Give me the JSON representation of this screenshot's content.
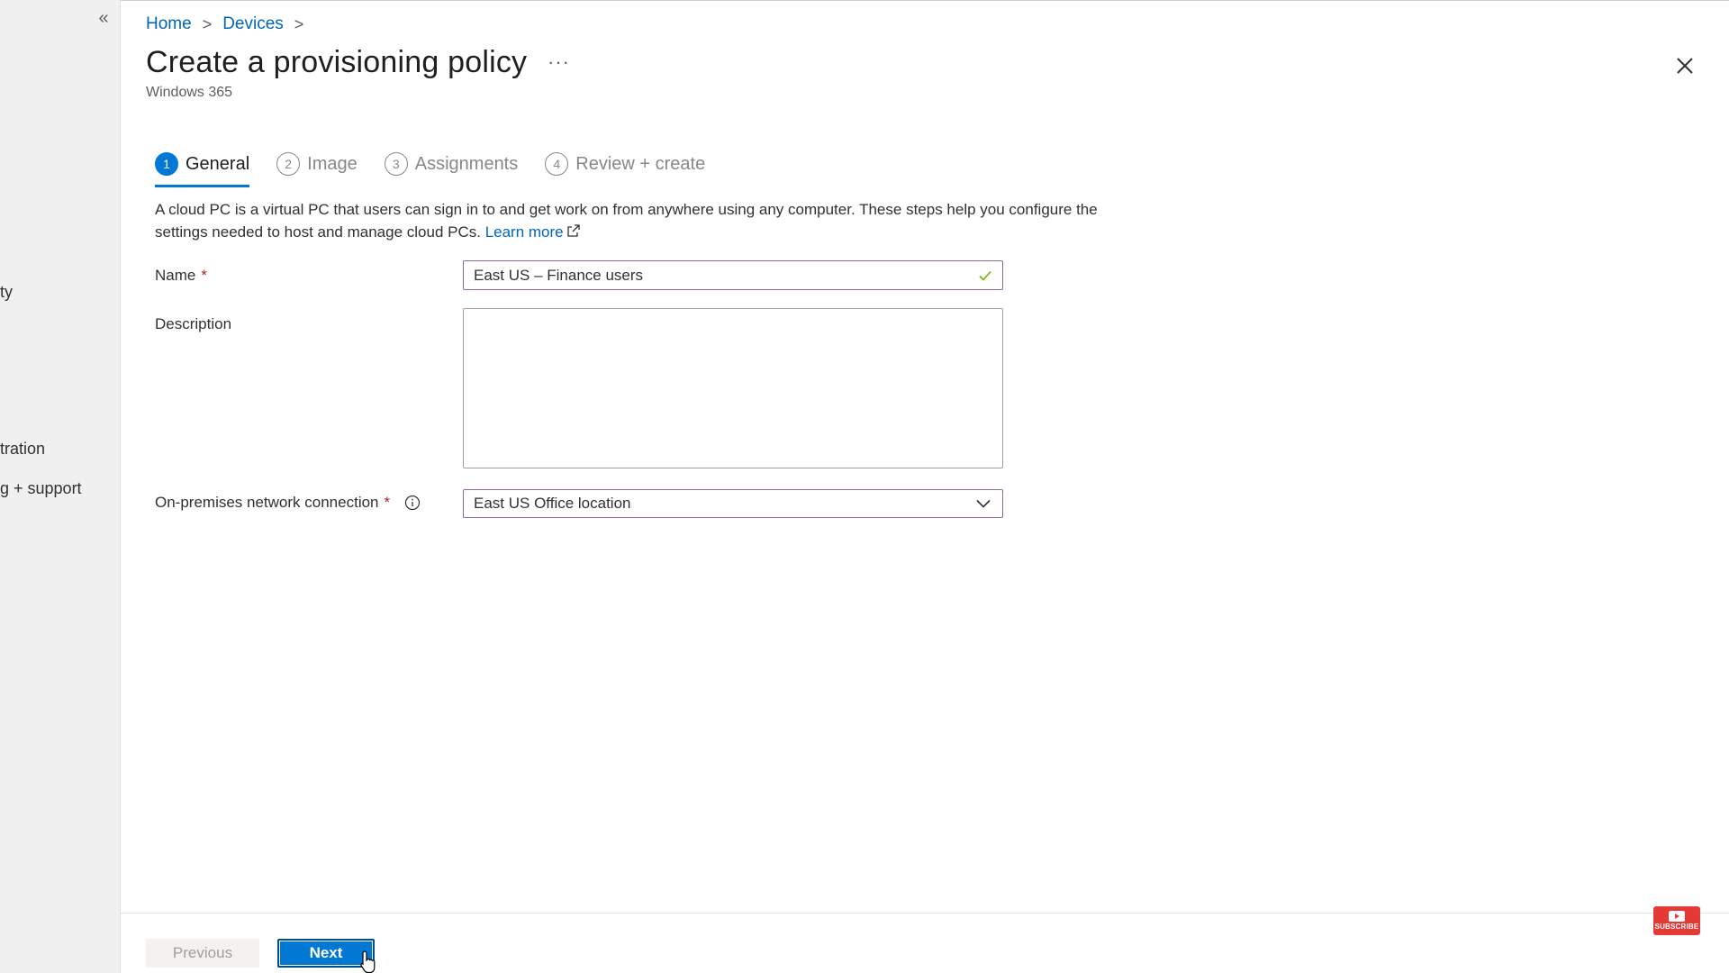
{
  "sidebar": {
    "collapse_label": "«",
    "items": [
      {
        "label": "ty"
      },
      {
        "label": "tration"
      },
      {
        "label": "g + support"
      }
    ]
  },
  "breadcrumb": {
    "items": [
      "Home",
      "Devices"
    ],
    "separator": ">"
  },
  "header": {
    "title": "Create a provisioning policy",
    "more_label": "···",
    "subtitle": "Windows 365"
  },
  "tabs": [
    {
      "number": "1",
      "label": "General",
      "active": true
    },
    {
      "number": "2",
      "label": "Image",
      "active": false
    },
    {
      "number": "3",
      "label": "Assignments",
      "active": false
    },
    {
      "number": "4",
      "label": "Review + create",
      "active": false
    }
  ],
  "intro": {
    "text": "A cloud PC is a virtual PC that users can sign in to and get work on from anywhere using any computer. These steps help you configure the settings needed to host and manage cloud PCs. ",
    "link_text": "Learn more"
  },
  "form": {
    "name": {
      "label": "Name",
      "required_mark": "*",
      "value": "East US – Finance users"
    },
    "description": {
      "label": "Description",
      "value": ""
    },
    "network": {
      "label": "On-premises network connection",
      "required_mark": "*",
      "value": "East US Office location"
    }
  },
  "footer": {
    "previous_label": "Previous",
    "next_label": "Next"
  },
  "overlay": {
    "subscribe_label": "SUBSCRIBE"
  },
  "colors": {
    "accent": "#0078d4",
    "link": "#0067b8",
    "required": "#a4262c",
    "valid_check": "#6bb700",
    "subscribe": "#e53935"
  },
  "icons": [
    "chevron-double-left-icon",
    "chevron-right-icon",
    "more-icon",
    "close-icon",
    "external-link-icon",
    "check-icon",
    "info-icon",
    "chevron-down-icon",
    "pointer-cursor-icon",
    "play-icon"
  ]
}
